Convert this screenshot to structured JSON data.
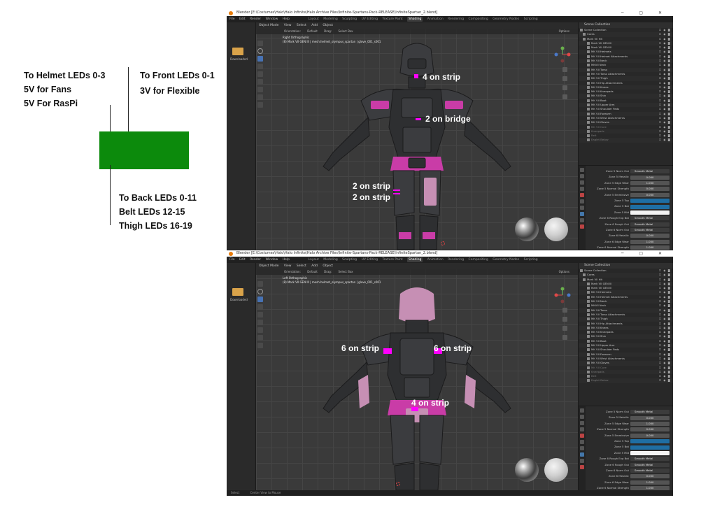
{
  "diagram": {
    "helmet_note": [
      "To Helmet LEDs 0-3",
      "5V for Fans",
      "5V For RasPi"
    ],
    "front_note": [
      "To Front LEDs 0-1",
      "3V for Flexible"
    ],
    "back_note": [
      "To Back LEDs 0-11",
      "Belt LEDs 12-15",
      "Thigh LEDs 16-19"
    ],
    "box_color": "#0c8a0c"
  },
  "window_top": {
    "title": "Blender [E:\\Costumes\\Halo\\Halo Infinite\\Halo Archive Files\\Infinite-Spartans-Pack-RELEASE\\InfiniteSpartan_2.blend]",
    "menu": [
      "File",
      "Edit",
      "Render",
      "Window",
      "Help"
    ],
    "workspaces": [
      "Layout",
      "Modeling",
      "Sculpting",
      "UV Editing",
      "Texture Paint",
      "Shading",
      "Animation",
      "Rendering",
      "Compositing",
      "Geometry Nodes",
      "Scripting"
    ],
    "active_workspace": "Shading",
    "viewport_header": [
      "Object Mode",
      "View",
      "Select",
      "Add",
      "Object"
    ],
    "viewport_sub": [
      "Orientation:",
      "Default",
      "Drag:",
      "Select Box"
    ],
    "options_label": "Options",
    "view_name": "Right Orthographic",
    "view_context": "(8) Mark VII GEN III | mesh.helmet_olympus_spartan | glove_001_s001",
    "annotations": [
      "4 on strip",
      "2 on bridge",
      "2 on strip",
      "2 on strip"
    ],
    "status": [
      "Select",
      "Center View to Mouse"
    ],
    "material_slot": "olympus_spartan | glove_001_s001"
  },
  "window_bottom": {
    "title": "Blender [E:\\Costumes\\Halo\\Halo Infinite\\Halo Archive Files\\Infinite-Spartans-Pack-RELEASE\\InfiniteSpartan_2.blend]",
    "view_name": "Left Orthographic",
    "view_context": "(8) Mark VII GEN III | mesh.helmet_olympus_spartan | glove_001_s001",
    "annotations": [
      "6 on strip",
      "6 on strip",
      "4 on strip"
    ],
    "status": [
      "Select",
      "Center View to Mouse"
    ]
  },
  "outliner": {
    "header": "Scene Collection",
    "rows": [
      "Scene Collection",
      "Cores",
      "Mark VII Hit",
      "Mark VII GEN III",
      "Mark VII GEN III",
      "MK VII Helmets",
      "MK VII Helmet Attachments",
      "MK VII Neck",
      "MKVII Neck",
      "MK VII Torso",
      "MK VII Torso Attachments",
      "MK VII Thigh",
      "MK VII Hip Attachments",
      "MK VII Knees",
      "MK VII Kneepads",
      "MK VII Shin",
      "MK VII Boot",
      "MK VII Upper Arm",
      "MK VII Shoulder Pads",
      "MK VII Forearm",
      "MK VII Wrist Attachments",
      "MK VII Gloves",
      "MK VII Core",
      "Kneepads",
      "Belt",
      "Eaglet Below"
    ]
  },
  "properties": {
    "rows": [
      {
        "label": "Zone 5 Norm Out",
        "value": "Smooth Metal",
        "style": "dark"
      },
      {
        "label": "Zone 5 Metallic",
        "value": "0.000",
        "style": ""
      },
      {
        "label": "Zone 5 Edge Wear",
        "value": "1.000",
        "style": ""
      },
      {
        "label": "Zone 5 Normal Strength",
        "value": "0.000",
        "style": ""
      },
      {
        "label": "Zone 5 Emmissive",
        "value": "0.000",
        "style": ""
      },
      {
        "label": "Zone 5 Top",
        "value": "",
        "style": "blue"
      },
      {
        "label": "Zone 5 Bot",
        "value": "",
        "style": "blue"
      },
      {
        "label": "Zone 5 Mid",
        "value": "",
        "style": "white"
      },
      {
        "label": "Zone 6 Rough Exp Bot",
        "value": "Smooth Metal",
        "style": "dark"
      },
      {
        "label": "Zone 6 Rough Out",
        "value": "Smooth Metal",
        "style": "dark"
      },
      {
        "label": "Zone 6 Norm Out",
        "value": "Smooth Metal",
        "style": "dark"
      },
      {
        "label": "Zone 6 Metallic",
        "value": "0.000",
        "style": ""
      },
      {
        "label": "Zone 6 Edge Wear",
        "value": "1.000",
        "style": ""
      },
      {
        "label": "Zone 6 Normal Strength",
        "value": "1.000",
        "style": ""
      },
      {
        "label": "Zone 6 Emmissive",
        "value": "0.000",
        "style": ""
      }
    ]
  },
  "left_editor": {
    "folder_label": "Downloaded"
  },
  "colors": {
    "led": "#ff00ff",
    "armor_accent": "#c93ca7",
    "blender_bg": "#303030"
  }
}
